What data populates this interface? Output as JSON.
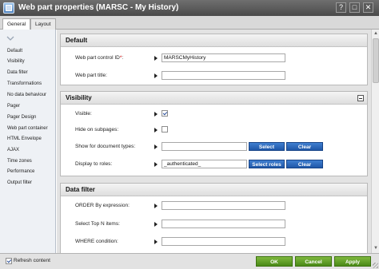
{
  "window": {
    "title": "Web part properties (MARSC - My History)",
    "help_glyph": "?",
    "maximize_glyph": "□",
    "close_glyph": "✕"
  },
  "tabs": [
    {
      "label": "General",
      "active": true
    },
    {
      "label": "Layout",
      "active": false
    }
  ],
  "sidebar": {
    "items": [
      "Default",
      "Visibility",
      "Data filter",
      "Transformations",
      "No data behaviour",
      "Pager",
      "Pager Design",
      "Web part container",
      "HTML Envelope",
      "AJAX",
      "Time zones",
      "Performance",
      "Output filter"
    ]
  },
  "sections": {
    "default": {
      "title": "Default",
      "control_id_label": "Web part control ID",
      "control_id_required": "*",
      "control_id_colon": ":",
      "control_id_value": "MARSCMyHistory",
      "title_label": "Web part title:",
      "title_value": ""
    },
    "visibility": {
      "title": "Visibility",
      "visible_label": "Visible:",
      "visible_checked": true,
      "hide_label": "Hide on subpages:",
      "hide_checked": false,
      "doc_types_label": "Show for document types:",
      "doc_types_value": "",
      "select_label": "Select",
      "clear_label": "Clear",
      "roles_label": "Display to roles:",
      "roles_value": "_authenticated_",
      "select_roles_label": "Select roles",
      "clear_roles_label": "Clear"
    },
    "data_filter": {
      "title": "Data filter",
      "order_label": "ORDER By expression:",
      "top_label": "Select Top N items:",
      "where_label": "WHERE condition:"
    }
  },
  "footer": {
    "refresh_label": "Refresh content",
    "refresh_checked": true,
    "ok_label": "OK",
    "cancel_label": "Cancel",
    "apply_label": "Apply"
  },
  "colors": {
    "title_bar": "#555555",
    "primary_button": "#2a66b8",
    "confirm_button": "#5f9e27"
  }
}
